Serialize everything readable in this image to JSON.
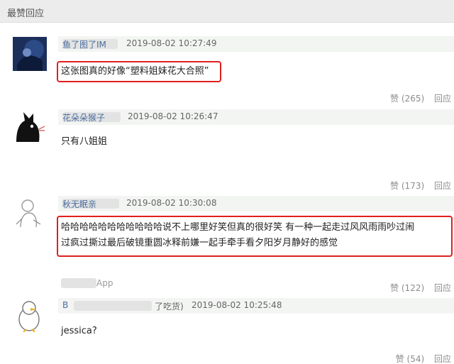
{
  "section": {
    "title": "最赞回应"
  },
  "comments": [
    {
      "username": "鱼了图了IM",
      "time": "2019-08-02 10:27:49",
      "text": "这张图真的好像“塑料姐妹花大合照”",
      "likes": "(265)",
      "reply": "回应"
    },
    {
      "username": "花朵朵猴子",
      "time": "2019-08-02 10:26:47",
      "text": "只有八姐姐",
      "likes": "(173)",
      "reply": "回应"
    },
    {
      "username": "秋无眠亲",
      "time": "2019-08-02 10:30:08",
      "text_line1": "哈哈哈哈哈哈哈哈哈哈哈说不上哪里好笑但真的很好笑 有一种一起走过风风雨雨吵过闹",
      "text_line2": "过疯过撕过最后破镜重圆冰释前嫌一起手牵手看夕阳岁月静好的感觉",
      "likes": "(122)",
      "reply": "回应"
    },
    {
      "app_tag": "App",
      "username": "B",
      "username_suffix": "了吃货)",
      "time": "2019-08-02 10:25:48",
      "text": "jessica?",
      "likes": "(54)",
      "reply": "回应"
    }
  ],
  "like_label": "赞",
  "icons": {
    "like": "thumbs-up-icon"
  }
}
